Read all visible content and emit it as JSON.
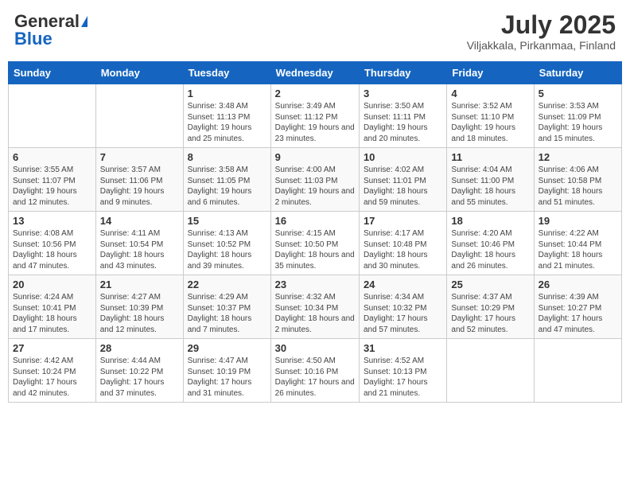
{
  "header": {
    "logo_general": "General",
    "logo_blue": "Blue",
    "month_title": "July 2025",
    "location": "Viljakkala, Pirkanmaa, Finland"
  },
  "days_of_week": [
    "Sunday",
    "Monday",
    "Tuesday",
    "Wednesday",
    "Thursday",
    "Friday",
    "Saturday"
  ],
  "weeks": [
    [
      {
        "day": "",
        "details": ""
      },
      {
        "day": "",
        "details": ""
      },
      {
        "day": "1",
        "details": "Sunrise: 3:48 AM\nSunset: 11:13 PM\nDaylight: 19 hours and 25 minutes."
      },
      {
        "day": "2",
        "details": "Sunrise: 3:49 AM\nSunset: 11:12 PM\nDaylight: 19 hours and 23 minutes."
      },
      {
        "day": "3",
        "details": "Sunrise: 3:50 AM\nSunset: 11:11 PM\nDaylight: 19 hours and 20 minutes."
      },
      {
        "day": "4",
        "details": "Sunrise: 3:52 AM\nSunset: 11:10 PM\nDaylight: 19 hours and 18 minutes."
      },
      {
        "day": "5",
        "details": "Sunrise: 3:53 AM\nSunset: 11:09 PM\nDaylight: 19 hours and 15 minutes."
      }
    ],
    [
      {
        "day": "6",
        "details": "Sunrise: 3:55 AM\nSunset: 11:07 PM\nDaylight: 19 hours and 12 minutes."
      },
      {
        "day": "7",
        "details": "Sunrise: 3:57 AM\nSunset: 11:06 PM\nDaylight: 19 hours and 9 minutes."
      },
      {
        "day": "8",
        "details": "Sunrise: 3:58 AM\nSunset: 11:05 PM\nDaylight: 19 hours and 6 minutes."
      },
      {
        "day": "9",
        "details": "Sunrise: 4:00 AM\nSunset: 11:03 PM\nDaylight: 19 hours and 2 minutes."
      },
      {
        "day": "10",
        "details": "Sunrise: 4:02 AM\nSunset: 11:01 PM\nDaylight: 18 hours and 59 minutes."
      },
      {
        "day": "11",
        "details": "Sunrise: 4:04 AM\nSunset: 11:00 PM\nDaylight: 18 hours and 55 minutes."
      },
      {
        "day": "12",
        "details": "Sunrise: 4:06 AM\nSunset: 10:58 PM\nDaylight: 18 hours and 51 minutes."
      }
    ],
    [
      {
        "day": "13",
        "details": "Sunrise: 4:08 AM\nSunset: 10:56 PM\nDaylight: 18 hours and 47 minutes."
      },
      {
        "day": "14",
        "details": "Sunrise: 4:11 AM\nSunset: 10:54 PM\nDaylight: 18 hours and 43 minutes."
      },
      {
        "day": "15",
        "details": "Sunrise: 4:13 AM\nSunset: 10:52 PM\nDaylight: 18 hours and 39 minutes."
      },
      {
        "day": "16",
        "details": "Sunrise: 4:15 AM\nSunset: 10:50 PM\nDaylight: 18 hours and 35 minutes."
      },
      {
        "day": "17",
        "details": "Sunrise: 4:17 AM\nSunset: 10:48 PM\nDaylight: 18 hours and 30 minutes."
      },
      {
        "day": "18",
        "details": "Sunrise: 4:20 AM\nSunset: 10:46 PM\nDaylight: 18 hours and 26 minutes."
      },
      {
        "day": "19",
        "details": "Sunrise: 4:22 AM\nSunset: 10:44 PM\nDaylight: 18 hours and 21 minutes."
      }
    ],
    [
      {
        "day": "20",
        "details": "Sunrise: 4:24 AM\nSunset: 10:41 PM\nDaylight: 18 hours and 17 minutes."
      },
      {
        "day": "21",
        "details": "Sunrise: 4:27 AM\nSunset: 10:39 PM\nDaylight: 18 hours and 12 minutes."
      },
      {
        "day": "22",
        "details": "Sunrise: 4:29 AM\nSunset: 10:37 PM\nDaylight: 18 hours and 7 minutes."
      },
      {
        "day": "23",
        "details": "Sunrise: 4:32 AM\nSunset: 10:34 PM\nDaylight: 18 hours and 2 minutes."
      },
      {
        "day": "24",
        "details": "Sunrise: 4:34 AM\nSunset: 10:32 PM\nDaylight: 17 hours and 57 minutes."
      },
      {
        "day": "25",
        "details": "Sunrise: 4:37 AM\nSunset: 10:29 PM\nDaylight: 17 hours and 52 minutes."
      },
      {
        "day": "26",
        "details": "Sunrise: 4:39 AM\nSunset: 10:27 PM\nDaylight: 17 hours and 47 minutes."
      }
    ],
    [
      {
        "day": "27",
        "details": "Sunrise: 4:42 AM\nSunset: 10:24 PM\nDaylight: 17 hours and 42 minutes."
      },
      {
        "day": "28",
        "details": "Sunrise: 4:44 AM\nSunset: 10:22 PM\nDaylight: 17 hours and 37 minutes."
      },
      {
        "day": "29",
        "details": "Sunrise: 4:47 AM\nSunset: 10:19 PM\nDaylight: 17 hours and 31 minutes."
      },
      {
        "day": "30",
        "details": "Sunrise: 4:50 AM\nSunset: 10:16 PM\nDaylight: 17 hours and 26 minutes."
      },
      {
        "day": "31",
        "details": "Sunrise: 4:52 AM\nSunset: 10:13 PM\nDaylight: 17 hours and 21 minutes."
      },
      {
        "day": "",
        "details": ""
      },
      {
        "day": "",
        "details": ""
      }
    ]
  ]
}
